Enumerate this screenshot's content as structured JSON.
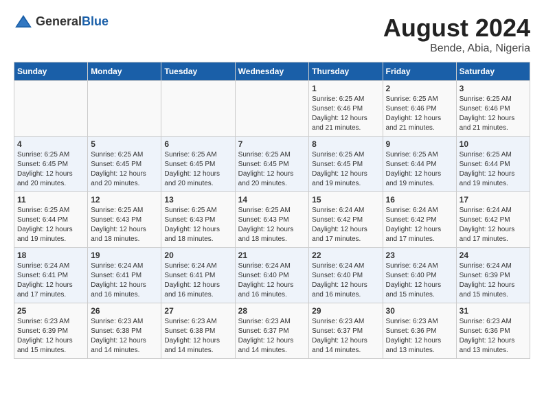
{
  "header": {
    "logo_general": "General",
    "logo_blue": "Blue",
    "title": "August 2024",
    "location": "Bende, Abia, Nigeria"
  },
  "weekdays": [
    "Sunday",
    "Monday",
    "Tuesday",
    "Wednesday",
    "Thursday",
    "Friday",
    "Saturday"
  ],
  "weeks": [
    [
      {
        "day": "",
        "info": ""
      },
      {
        "day": "",
        "info": ""
      },
      {
        "day": "",
        "info": ""
      },
      {
        "day": "",
        "info": ""
      },
      {
        "day": "1",
        "info": "Sunrise: 6:25 AM\nSunset: 6:46 PM\nDaylight: 12 hours\nand 21 minutes."
      },
      {
        "day": "2",
        "info": "Sunrise: 6:25 AM\nSunset: 6:46 PM\nDaylight: 12 hours\nand 21 minutes."
      },
      {
        "day": "3",
        "info": "Sunrise: 6:25 AM\nSunset: 6:46 PM\nDaylight: 12 hours\nand 21 minutes."
      }
    ],
    [
      {
        "day": "4",
        "info": "Sunrise: 6:25 AM\nSunset: 6:45 PM\nDaylight: 12 hours\nand 20 minutes."
      },
      {
        "day": "5",
        "info": "Sunrise: 6:25 AM\nSunset: 6:45 PM\nDaylight: 12 hours\nand 20 minutes."
      },
      {
        "day": "6",
        "info": "Sunrise: 6:25 AM\nSunset: 6:45 PM\nDaylight: 12 hours\nand 20 minutes."
      },
      {
        "day": "7",
        "info": "Sunrise: 6:25 AM\nSunset: 6:45 PM\nDaylight: 12 hours\nand 20 minutes."
      },
      {
        "day": "8",
        "info": "Sunrise: 6:25 AM\nSunset: 6:45 PM\nDaylight: 12 hours\nand 19 minutes."
      },
      {
        "day": "9",
        "info": "Sunrise: 6:25 AM\nSunset: 6:44 PM\nDaylight: 12 hours\nand 19 minutes."
      },
      {
        "day": "10",
        "info": "Sunrise: 6:25 AM\nSunset: 6:44 PM\nDaylight: 12 hours\nand 19 minutes."
      }
    ],
    [
      {
        "day": "11",
        "info": "Sunrise: 6:25 AM\nSunset: 6:44 PM\nDaylight: 12 hours\nand 19 minutes."
      },
      {
        "day": "12",
        "info": "Sunrise: 6:25 AM\nSunset: 6:43 PM\nDaylight: 12 hours\nand 18 minutes."
      },
      {
        "day": "13",
        "info": "Sunrise: 6:25 AM\nSunset: 6:43 PM\nDaylight: 12 hours\nand 18 minutes."
      },
      {
        "day": "14",
        "info": "Sunrise: 6:25 AM\nSunset: 6:43 PM\nDaylight: 12 hours\nand 18 minutes."
      },
      {
        "day": "15",
        "info": "Sunrise: 6:24 AM\nSunset: 6:42 PM\nDaylight: 12 hours\nand 17 minutes."
      },
      {
        "day": "16",
        "info": "Sunrise: 6:24 AM\nSunset: 6:42 PM\nDaylight: 12 hours\nand 17 minutes."
      },
      {
        "day": "17",
        "info": "Sunrise: 6:24 AM\nSunset: 6:42 PM\nDaylight: 12 hours\nand 17 minutes."
      }
    ],
    [
      {
        "day": "18",
        "info": "Sunrise: 6:24 AM\nSunset: 6:41 PM\nDaylight: 12 hours\nand 17 minutes."
      },
      {
        "day": "19",
        "info": "Sunrise: 6:24 AM\nSunset: 6:41 PM\nDaylight: 12 hours\nand 16 minutes."
      },
      {
        "day": "20",
        "info": "Sunrise: 6:24 AM\nSunset: 6:41 PM\nDaylight: 12 hours\nand 16 minutes."
      },
      {
        "day": "21",
        "info": "Sunrise: 6:24 AM\nSunset: 6:40 PM\nDaylight: 12 hours\nand 16 minutes."
      },
      {
        "day": "22",
        "info": "Sunrise: 6:24 AM\nSunset: 6:40 PM\nDaylight: 12 hours\nand 16 minutes."
      },
      {
        "day": "23",
        "info": "Sunrise: 6:24 AM\nSunset: 6:40 PM\nDaylight: 12 hours\nand 15 minutes."
      },
      {
        "day": "24",
        "info": "Sunrise: 6:24 AM\nSunset: 6:39 PM\nDaylight: 12 hours\nand 15 minutes."
      }
    ],
    [
      {
        "day": "25",
        "info": "Sunrise: 6:23 AM\nSunset: 6:39 PM\nDaylight: 12 hours\nand 15 minutes."
      },
      {
        "day": "26",
        "info": "Sunrise: 6:23 AM\nSunset: 6:38 PM\nDaylight: 12 hours\nand 14 minutes."
      },
      {
        "day": "27",
        "info": "Sunrise: 6:23 AM\nSunset: 6:38 PM\nDaylight: 12 hours\nand 14 minutes."
      },
      {
        "day": "28",
        "info": "Sunrise: 6:23 AM\nSunset: 6:37 PM\nDaylight: 12 hours\nand 14 minutes."
      },
      {
        "day": "29",
        "info": "Sunrise: 6:23 AM\nSunset: 6:37 PM\nDaylight: 12 hours\nand 14 minutes."
      },
      {
        "day": "30",
        "info": "Sunrise: 6:23 AM\nSunset: 6:36 PM\nDaylight: 12 hours\nand 13 minutes."
      },
      {
        "day": "31",
        "info": "Sunrise: 6:23 AM\nSunset: 6:36 PM\nDaylight: 12 hours\nand 13 minutes."
      }
    ]
  ]
}
